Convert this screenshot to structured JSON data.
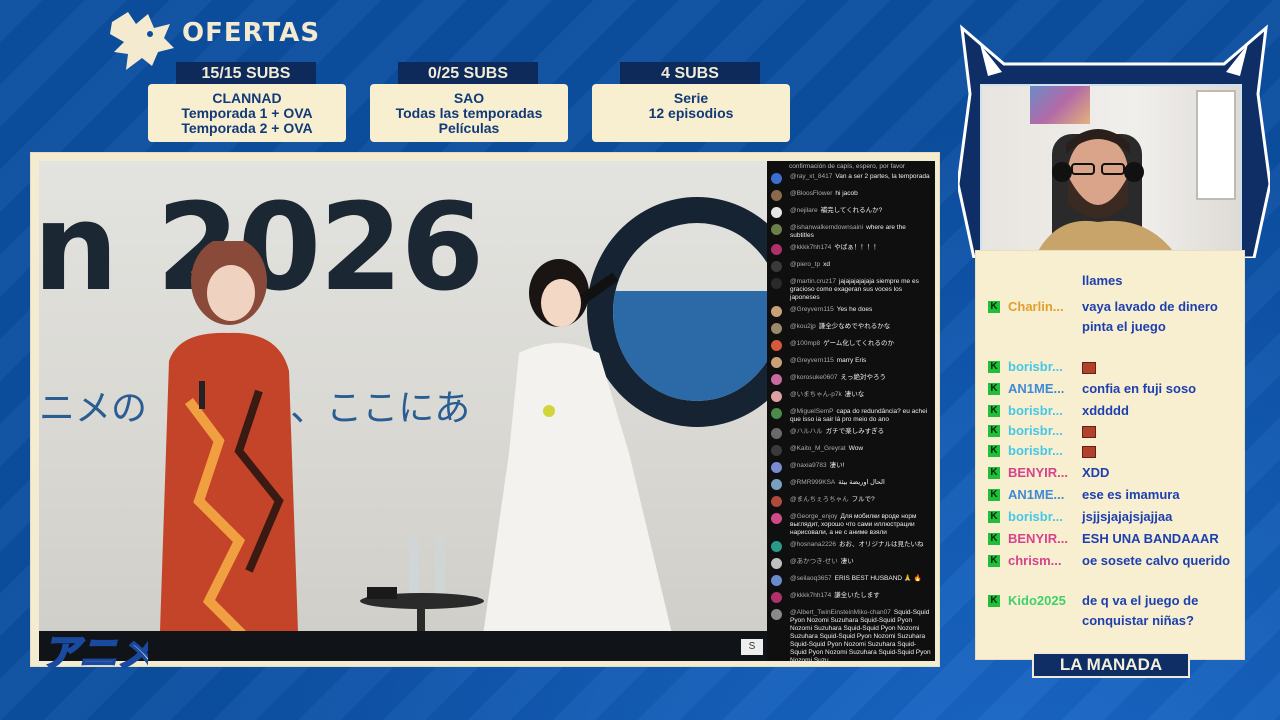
{
  "header": {
    "brand_title": "OFERTAS"
  },
  "offers": [
    {
      "badge": "15/15 SUBS",
      "line1": "CLANNAD",
      "line2": "Temporada 1 + OVA",
      "line3": "Temporada 2 + OVA"
    },
    {
      "badge": "0/25 SUBS",
      "line1": "SAO",
      "line2": "Todas las temporadas",
      "line3": "Películas"
    },
    {
      "badge": "4 SUBS",
      "line1": "Serie",
      "line2": "12 episodios",
      "line3": ""
    }
  ],
  "video": {
    "stage_year": "n 2026",
    "stage_japanese": "ニメの　　　が、ここにあ",
    "corner_icon": "S"
  },
  "youtube_chat": {
    "top_line": "confirmación de capís, espero, por favor",
    "messages": [
      {
        "user": "@ray_xt_8417",
        "text": "Van a ser 2 partes, la temporada",
        "color": "#3d6fd1"
      },
      {
        "user": "@BloosFlower",
        "text": "hi jacob",
        "color": "#8a6a4a"
      },
      {
        "user": "@nejilare",
        "text": "補完してくれるんか?",
        "color": "#e6e6e6"
      },
      {
        "user": "@ishanwalkemdownsaini",
        "text": "where are the subtitles",
        "color": "#6a7f4a"
      },
      {
        "user": "@kkkk7hh174",
        "text": "やばぁ！！！！",
        "color": "#b0306a"
      },
      {
        "user": "@piero_tp",
        "text": "xd",
        "color": "#3a3a3a"
      },
      {
        "user": "@martin.cruz17",
        "text": "jajajajajajaja siempre me es gracioso como exageran sus voces los japoneses",
        "color": "#2a2a2a"
      },
      {
        "user": "@Greyvern115",
        "text": "Yes he does",
        "color": "#c9a07a"
      },
      {
        "user": "@kou2jp",
        "text": "謙全少なめでやれるかな",
        "color": "#9a8a6a"
      },
      {
        "user": "@100mp8",
        "text": "ゲーム化してくれるのか",
        "color": "#d65a3a"
      },
      {
        "user": "@Greyvern115",
        "text": "marry Eris",
        "color": "#c9a07a"
      },
      {
        "user": "@korosuke0607",
        "text": "えっ絶対やろう",
        "color": "#c86aa0"
      },
      {
        "user": "@いまちゃん-p7k",
        "text": "凄いな",
        "color": "#e0a0a0"
      },
      {
        "user": "@MiguelSemP",
        "text": "capa do redundância? eu achei que isso ia sair lá pro meio do ano",
        "color": "#4a8a4a"
      },
      {
        "user": "@ハルハル",
        "text": "ガチで楽しみすぎる",
        "color": "#6a6a6a"
      },
      {
        "user": "@Kaito_M_Greyrat",
        "text": "Wow",
        "color": "#3a3a3a"
      },
      {
        "user": "@naxia9783",
        "text": "凄い!",
        "color": "#7a8ad0"
      },
      {
        "user": "@RMR999KSA",
        "text": "الحال اوريضة بيئة",
        "color": "#7aa0c0"
      },
      {
        "user": "@まんちぇろちゃん",
        "text": "フルで?",
        "color": "#b04a3a"
      },
      {
        "user": "@George_enjoy",
        "text": "Для мобилки вроде норм выглядит, хорошо что сами иллюстрации нарисовали, а не с аниме взяли",
        "color": "#d04a8a"
      },
      {
        "user": "@hosnana2226",
        "text": "おお、オリジナルは見たいね",
        "color": "#2a9a8a"
      },
      {
        "user": "@あかつき-せい",
        "text": "凄い",
        "color": "#c0c0c0"
      },
      {
        "user": "@seilaoq3657",
        "text": "ERIS BEST HUSBAND 🙏 🔥",
        "color": "#6a8ad0"
      },
      {
        "user": "@kkkk7hh174",
        "text": "謙全いたします",
        "color": "#b0306a"
      },
      {
        "user": "@Albert_TwinEinsteinMiko-chan07",
        "text": "Squid-Squid Pyon Nozomi Suzuhara Squid-Squid Pyon Nozomi Suzuhara Squid-Squid Pyon Nozomi Suzuhara Squid-Squid Pyon Nozomi Suzuhara Squid-Squid Pyon Nozomi Suzuhara Squid-Squid Pyon Nozomi Suzuhara Squid-Squid Pyon Nozomi Suzu",
        "color": "#8a8a8a"
      }
    ]
  },
  "twitch_chat": {
    "lines": [
      {
        "user": "",
        "user_color": "#e0a030",
        "message": "llames",
        "badge": false
      },
      {
        "user": "Charlin...",
        "user_color": "#e0a030",
        "message": "vaya lavado de dinero pinta el juego",
        "badge": true
      },
      {
        "user": "borisbr...",
        "user_color": "#46c7e8",
        "message": "",
        "emote": true,
        "badge": true
      },
      {
        "user": "AN1ME...",
        "user_color": "#3f8ad6",
        "message": "confia en fuji soso",
        "badge": true
      },
      {
        "user": "borisbr...",
        "user_color": "#46c7e8",
        "message": "xddddd",
        "badge": true
      },
      {
        "user": "borisbr...",
        "user_color": "#46c7e8",
        "message": "",
        "emote": true,
        "badge": true
      },
      {
        "user": "borisbr...",
        "user_color": "#46c7e8",
        "message": "",
        "emote": true,
        "badge": true
      },
      {
        "user": "BENYIR...",
        "user_color": "#d7428c",
        "message": "XDD",
        "badge": true
      },
      {
        "user": "AN1ME...",
        "user_color": "#3f8ad6",
        "message": "ese es imamura",
        "badge": true
      },
      {
        "user": "borisbr...",
        "user_color": "#46c7e8",
        "message": "jsjjsjajajsjajjaa",
        "badge": true
      },
      {
        "user": "BENYIR...",
        "user_color": "#d7428c",
        "message": "ESH UNA BANDAAAR",
        "badge": true
      },
      {
        "user": "chrism...",
        "user_color": "#d7428c",
        "message": "oe sosete calvo querido",
        "badge": true
      },
      {
        "user": "Kido2025",
        "user_color": "#3fd16a",
        "message": "de q va el juego de conquistar niñas?",
        "badge": true
      }
    ]
  },
  "footer": {
    "anime_logo": "アニメ",
    "manada_label": "LA MANADA"
  },
  "colors": {
    "background": "#0b4ea0",
    "card": "#f7efd0",
    "badge_dark": "#0d2a5a",
    "chat_text": "#1d3fb0",
    "twitch_badge": "#1fbf3a"
  }
}
